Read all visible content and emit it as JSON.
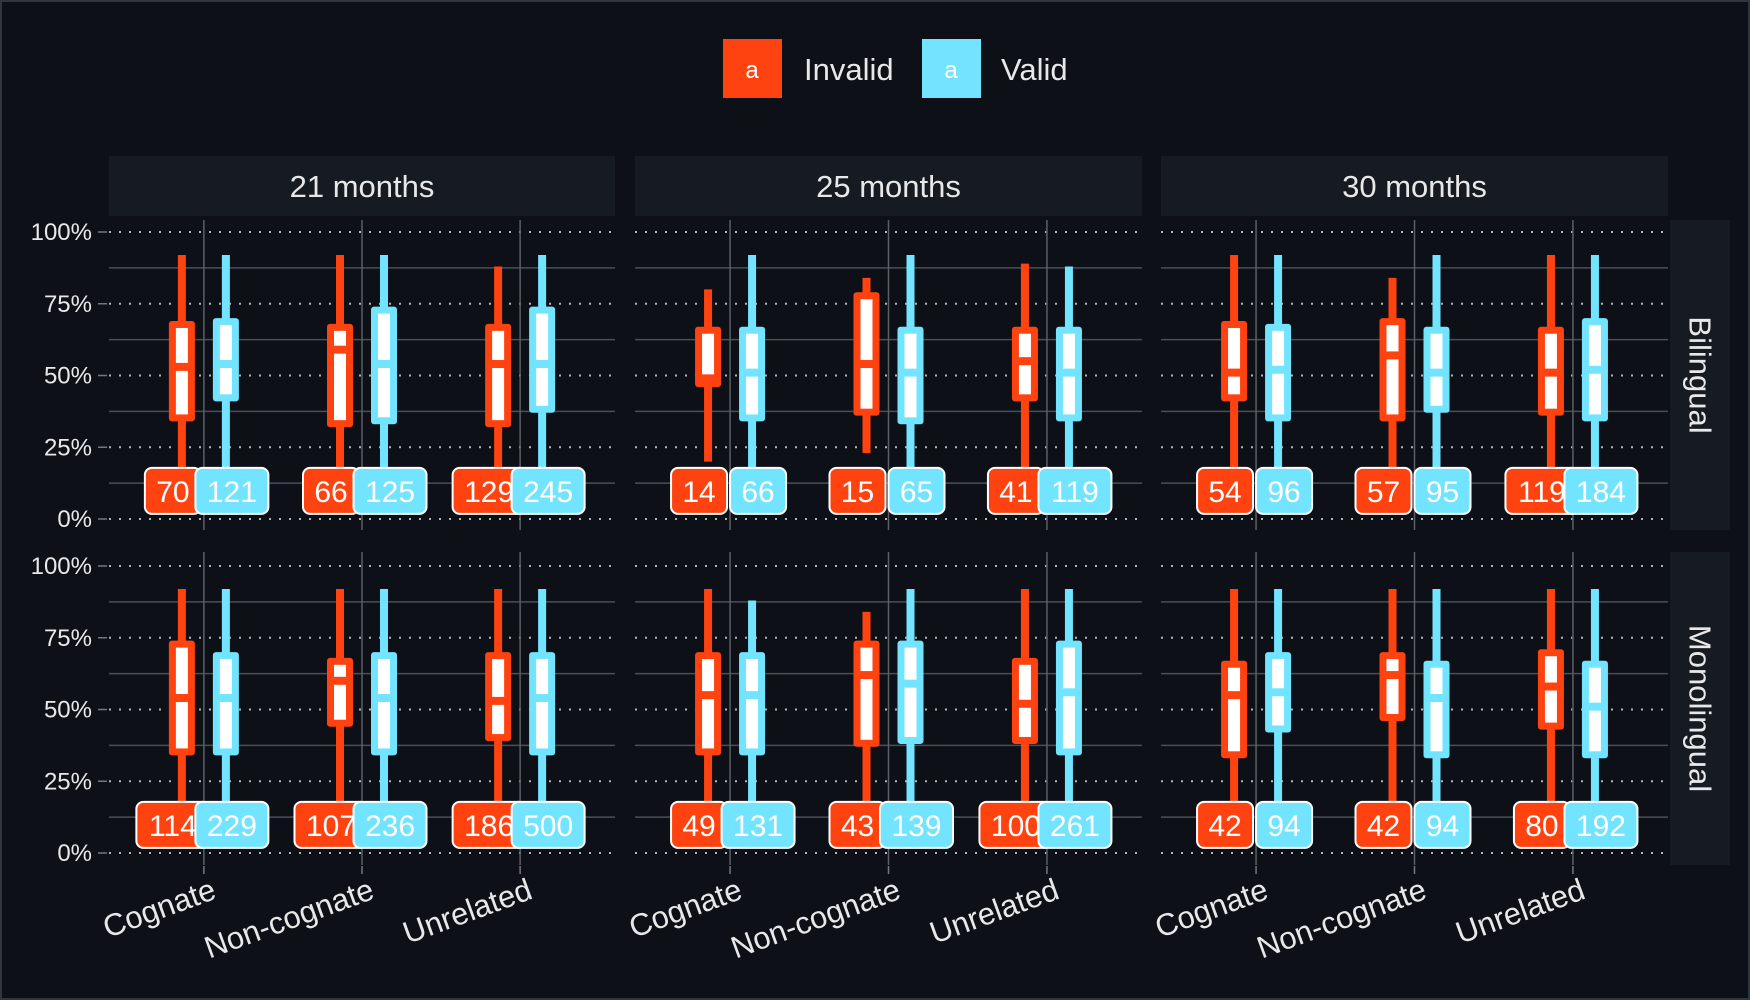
{
  "chart_data": {
    "type": "boxplot",
    "legend": {
      "key_glyph": "a",
      "entries": [
        {
          "name": "Invalid",
          "color": "#ff4310"
        },
        {
          "name": "Valid",
          "color": "#72e4ff"
        }
      ],
      "placement": "top"
    },
    "columns": [
      "21 months",
      "25 months",
      "30 months"
    ],
    "rows": [
      "Bilingual",
      "Monolingual"
    ],
    "categories": [
      "Cognate",
      "Non-cognate",
      "Unrelated"
    ],
    "y_ticks": [
      "0%",
      "25%",
      "50%",
      "75%",
      "100%"
    ],
    "ylim": [
      0,
      100
    ],
    "value_order": [
      "min",
      "q1",
      "median",
      "q3",
      "max",
      "n"
    ],
    "panels": [
      {
        "row": "Bilingual",
        "column": "21 months",
        "boxes": [
          {
            "Invalid": [
              10,
              34,
              53,
              69,
              92,
              70
            ],
            "Valid": [
              10,
              41,
              54,
              70,
              92,
              121
            ]
          },
          {
            "Invalid": [
              10,
              32,
              59,
              68,
              92,
              66
            ],
            "Valid": [
              10,
              33,
              54,
              74,
              92,
              125
            ]
          },
          {
            "Invalid": [
              10,
              32,
              54,
              68,
              88,
              129
            ],
            "Valid": [
              10,
              37,
              54,
              74,
              92,
              245
            ]
          }
        ]
      },
      {
        "row": "Bilingual",
        "column": "25 months",
        "boxes": [
          {
            "Invalid": [
              20,
              46,
              49,
              67,
              80,
              14
            ],
            "Valid": [
              10,
              34,
              51,
              67,
              92,
              66
            ]
          },
          {
            "Invalid": [
              23,
              36,
              54,
              79,
              84,
              15
            ],
            "Valid": [
              10,
              33,
              51,
              67,
              92,
              65
            ]
          },
          {
            "Invalid": [
              10,
              41,
              55,
              67,
              89,
              41
            ],
            "Valid": [
              10,
              34,
              51,
              67,
              88,
              119
            ]
          }
        ]
      },
      {
        "row": "Bilingual",
        "column": "30 months",
        "boxes": [
          {
            "Invalid": [
              10,
              41,
              51,
              69,
              92,
              54
            ],
            "Valid": [
              10,
              34,
              52,
              68,
              92,
              96
            ]
          },
          {
            "Invalid": [
              10,
              34,
              57,
              70,
              84,
              57
            ],
            "Valid": [
              10,
              37,
              51,
              67,
              92,
              95
            ]
          },
          {
            "Invalid": [
              10,
              36,
              51,
              67,
              92,
              119
            ],
            "Valid": [
              10,
              34,
              52,
              70,
              92,
              184
            ]
          }
        ]
      },
      {
        "row": "Monolingual",
        "column": "21 months",
        "boxes": [
          {
            "Invalid": [
              10,
              34,
              54,
              74,
              92,
              114
            ],
            "Valid": [
              10,
              34,
              54,
              70,
              92,
              229
            ]
          },
          {
            "Invalid": [
              10,
              44,
              60,
              68,
              92,
              107
            ],
            "Valid": [
              10,
              34,
              54,
              70,
              92,
              236
            ]
          },
          {
            "Invalid": [
              10,
              39,
              53,
              70,
              92,
              186
            ],
            "Valid": [
              10,
              34,
              54,
              70,
              92,
              500
            ]
          }
        ]
      },
      {
        "row": "Monolingual",
        "column": "25 months",
        "boxes": [
          {
            "Invalid": [
              10,
              34,
              55,
              70,
              92,
              49
            ],
            "Valid": [
              10,
              34,
              55,
              70,
              88,
              131
            ]
          },
          {
            "Invalid": [
              10,
              37,
              62,
              74,
              84,
              43
            ],
            "Valid": [
              10,
              38,
              59,
              74,
              92,
              139
            ]
          },
          {
            "Invalid": [
              10,
              38,
              52,
              68,
              92,
              100
            ],
            "Valid": [
              10,
              34,
              56,
              74,
              92,
              261
            ]
          }
        ]
      },
      {
        "row": "Monolingual",
        "column": "30 months",
        "boxes": [
          {
            "Invalid": [
              10,
              33,
              55,
              67,
              92,
              42
            ],
            "Valid": [
              10,
              42,
              56,
              70,
              92,
              94
            ]
          },
          {
            "Invalid": [
              10,
              46,
              62,
              70,
              92,
              42
            ],
            "Valid": [
              10,
              33,
              54,
              67,
              92,
              94
            ]
          },
          {
            "Invalid": [
              10,
              43,
              58,
              71,
              92,
              80
            ],
            "Valid": [
              10,
              33,
              51,
              67,
              92,
              192
            ]
          }
        ]
      }
    ]
  }
}
